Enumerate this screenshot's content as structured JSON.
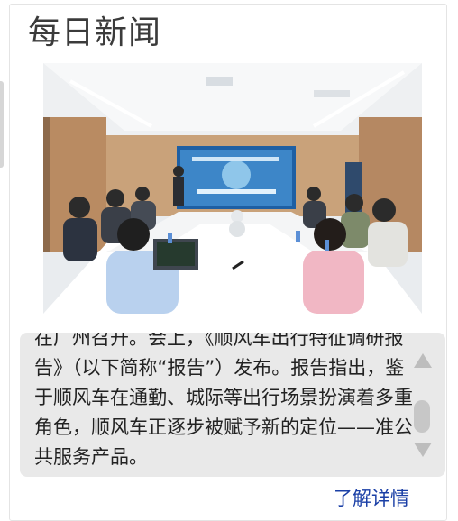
{
  "widget": {
    "title": "每日新闻",
    "article_text": "在广州召开。会上，《顺风车出行特征调研报告》（以下简称“报告”）发布。报告指出，鉴于顺风车在通勤、城际等出行场景扮演着多重角色，顺风车正逐步被赋予新的定位——准公共服务产品。",
    "more_link": "了解详情"
  },
  "colors": {
    "title": "#3b3b3b",
    "link": "#1a3fa6",
    "text_box_bg": "#e9e9e9"
  },
  "icons": {
    "scroll_up": "triangle-up-icon",
    "scroll_down": "triangle-down-icon"
  }
}
